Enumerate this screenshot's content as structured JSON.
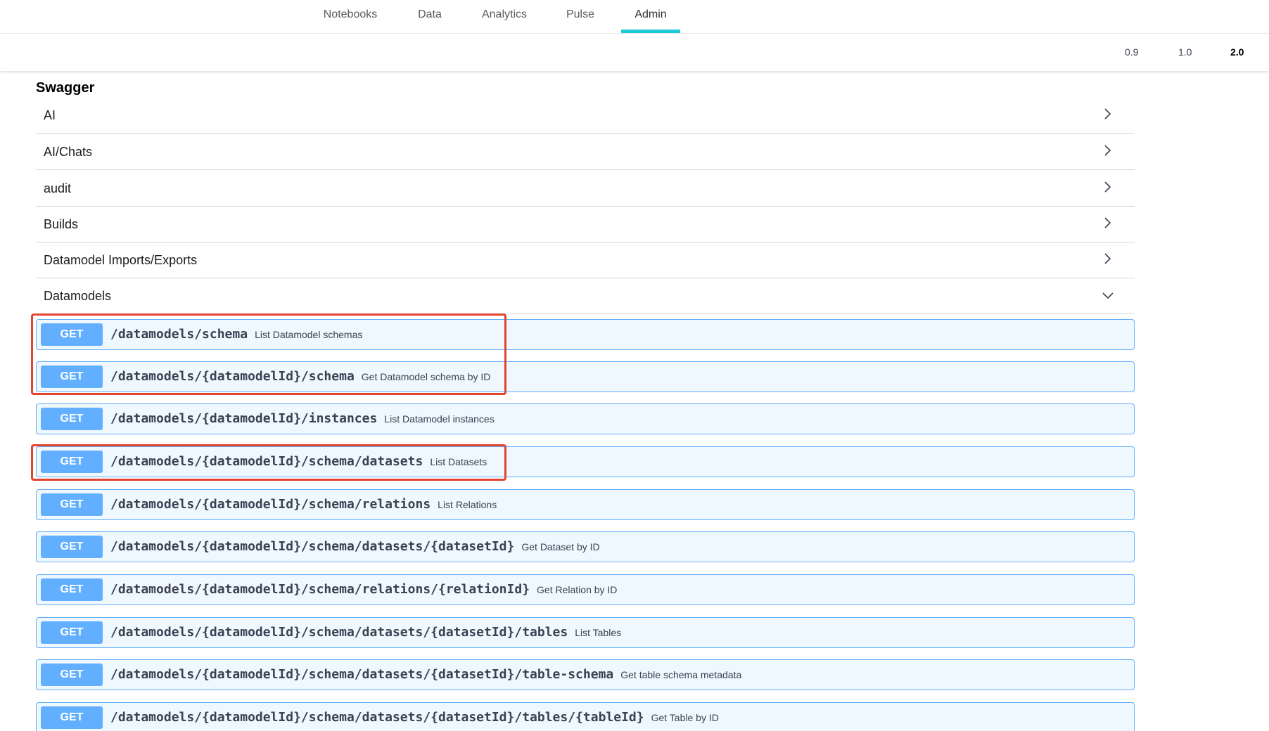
{
  "nav": {
    "tabs": [
      {
        "label": "Notebooks"
      },
      {
        "label": "Data"
      },
      {
        "label": "Analytics"
      },
      {
        "label": "Pulse"
      },
      {
        "label": "Admin",
        "active": true
      }
    ]
  },
  "versions": [
    "0.9",
    "1.0",
    "2.0"
  ],
  "active_version": "2.0",
  "page": {
    "title": "Swagger"
  },
  "tags": [
    {
      "name": "AI",
      "expanded": false
    },
    {
      "name": "AI/Chats",
      "expanded": false
    },
    {
      "name": "audit",
      "expanded": false
    },
    {
      "name": "Builds",
      "expanded": false
    },
    {
      "name": "Datamodel Imports/Exports",
      "expanded": false
    },
    {
      "name": "Datamodels",
      "expanded": true
    }
  ],
  "operations": [
    {
      "method": "GET",
      "path": "/datamodels/schema",
      "summary": "List Datamodel schemas"
    },
    {
      "method": "GET",
      "path": "/datamodels/{datamodelId}/schema",
      "summary": "Get Datamodel schema by ID"
    },
    {
      "method": "GET",
      "path": "/datamodels/{datamodelId}/instances",
      "summary": "List Datamodel instances"
    },
    {
      "method": "GET",
      "path": "/datamodels/{datamodelId}/schema/datasets",
      "summary": "List Datasets"
    },
    {
      "method": "GET",
      "path": "/datamodels/{datamodelId}/schema/relations",
      "summary": "List Relations"
    },
    {
      "method": "GET",
      "path": "/datamodels/{datamodelId}/schema/datasets/{datasetId}",
      "summary": "Get Dataset by ID"
    },
    {
      "method": "GET",
      "path": "/datamodels/{datamodelId}/schema/relations/{relationId}",
      "summary": "Get Relation by ID"
    },
    {
      "method": "GET",
      "path": "/datamodels/{datamodelId}/schema/datasets/{datasetId}/tables",
      "summary": "List Tables"
    },
    {
      "method": "GET",
      "path": "/datamodels/{datamodelId}/schema/datasets/{datasetId}/table-schema",
      "summary": "Get table schema metadata"
    },
    {
      "method": "GET",
      "path": "/datamodels/{datamodelId}/schema/datasets/{datasetId}/tables/{tableId}",
      "summary": "Get Table by ID"
    }
  ],
  "colors": {
    "accent": "#1ec9d8",
    "get_method": "#61affe",
    "get_background": "#eff7ff",
    "highlight": "#e4432f"
  }
}
